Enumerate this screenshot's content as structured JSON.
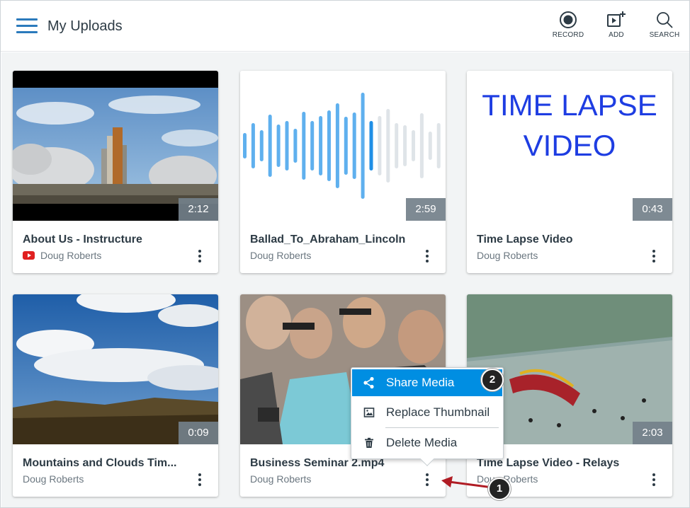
{
  "header": {
    "title": "My Uploads",
    "menu_icon": "hamburger-menu-icon",
    "tools": [
      {
        "label": "RECORD",
        "icon": "record-icon"
      },
      {
        "label": "ADD",
        "icon": "add-media-icon"
      },
      {
        "label": "SEARCH",
        "icon": "search-icon"
      }
    ]
  },
  "media": [
    {
      "title": "About Us - Instructure",
      "owner": "Doug Roberts",
      "duration": "2:12",
      "source_icon": "youtube-icon"
    },
    {
      "title": "Ballad_To_Abraham_Lincoln",
      "owner": "Doug Roberts",
      "duration": "2:59"
    },
    {
      "title": "Time Lapse Video",
      "owner": "Doug Roberts",
      "duration": "0:43",
      "thumb_text": [
        "TIME LAPSE",
        "VIDEO"
      ]
    },
    {
      "title": "Mountains and Clouds Tim...",
      "owner": "Doug Roberts",
      "duration": "0:09"
    },
    {
      "title": "Business Seminar 2.mp4",
      "owner": "Doug Roberts",
      "duration": ""
    },
    {
      "title": "Time Lapse Video - Relays",
      "owner": "Doug Roberts",
      "duration": "2:03"
    }
  ],
  "context_menu": {
    "items": [
      {
        "label": "Share Media",
        "icon": "share-icon",
        "active": true
      },
      {
        "label": "Replace Thumbnail",
        "icon": "image-icon"
      },
      {
        "label": "Delete Media",
        "icon": "trash-icon"
      }
    ]
  },
  "callouts": [
    "1",
    "2"
  ],
  "colors": {
    "accent": "#008ee2",
    "header_icon": "#2b7abc",
    "text": "#2d3b45",
    "muted": "#6b7780",
    "duration_badge": "#73808a",
    "callout_arrow": "#b01c24"
  }
}
